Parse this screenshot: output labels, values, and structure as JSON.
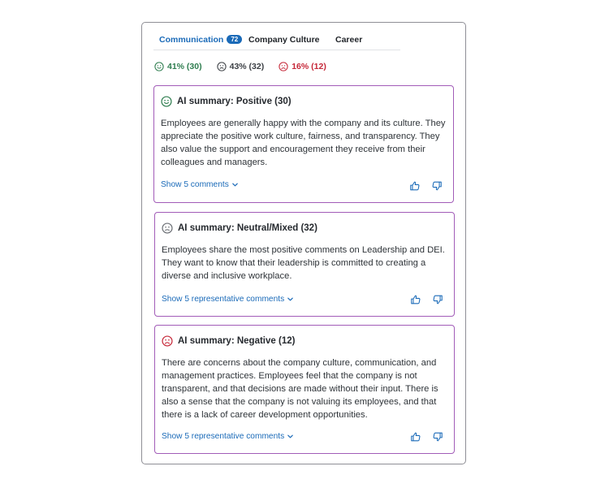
{
  "tabs": [
    {
      "label": "Communication",
      "count": "72",
      "active": true
    },
    {
      "label": "Company Culture"
    },
    {
      "label": "Career"
    }
  ],
  "stats": {
    "positive": "41% (30)",
    "neutral": "43% (32)",
    "negative": "16% (12)"
  },
  "colors": {
    "positive": "#2e7d4f",
    "neutral": "#3b3f44",
    "negative": "#c62839",
    "accent": "#1a6ab8",
    "card_border": "#a25cb8"
  },
  "cards": [
    {
      "icon": "smiley-positive-icon",
      "title": "AI summary: Positive (30)",
      "body": "Employees are generally happy with the company and its culture. They appreciate the positive work culture, fairness, and transparency. They also value the support and encouragement they receive from their colleagues and managers.",
      "link": "Show 5 comments"
    },
    {
      "icon": "smiley-neutral-icon",
      "title": "AI summary: Neutral/Mixed (32)",
      "body": "Employees share the most positive comments on Leadership and DEI. They want to know that their leadership is committed to creating a diverse and inclusive workplace.",
      "link": "Show 5 representative comments"
    },
    {
      "icon": "smiley-negative-icon",
      "title": "AI summary: Negative (12)",
      "body": "There are concerns about the company culture, communication, and management practices. Employees feel that the company is not transparent, and that decisions are made without their input. There is also a sense that the company is not valuing its employees, and that there is a lack of career development opportunities.",
      "link": "Show 5 representative comments"
    }
  ]
}
